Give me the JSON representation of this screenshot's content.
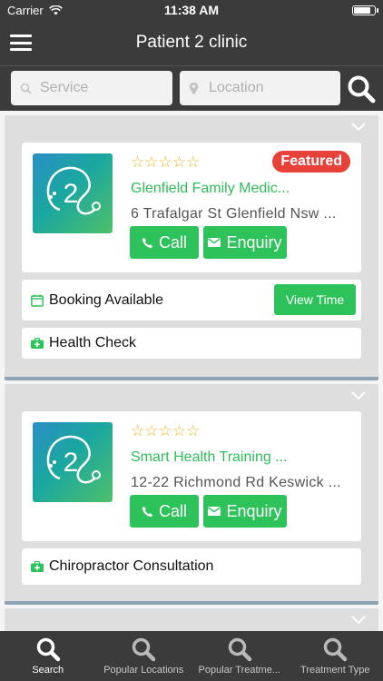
{
  "status_bar": {
    "carrier": "Carrier",
    "time": "11:38 AM"
  },
  "header": {
    "title": "Patient 2 clinic"
  },
  "search": {
    "service_placeholder": "Service",
    "location_placeholder": "Location"
  },
  "colors": {
    "bar": "#3b3b3b",
    "accent_green": "#2dc25a",
    "name_green": "#2fbd5a",
    "featured_red": "#e8413a",
    "star": "#e3b820"
  },
  "listings": [
    {
      "stars": "☆☆☆☆☆",
      "rating": 0,
      "badge": "Featured",
      "name": "Glenfield Family Medic...",
      "address": "6 Trafalgar St Glenfield  Nsw  ...",
      "call_label": "Call",
      "enquiry_label": "Enquiry",
      "booking_label": "Booking Available",
      "view_time_label": "View Time",
      "service": "Health Check"
    },
    {
      "stars": "☆☆☆☆☆",
      "rating": 0,
      "name": "Smart Health Training ...",
      "address": "12-22 Richmond Rd Keswick  ...",
      "call_label": "Call",
      "enquiry_label": "Enquiry",
      "service": "Chiropractor Consultation"
    }
  ],
  "tabs": [
    {
      "label": "Search",
      "icon": "search-icon",
      "active": true
    },
    {
      "label": "Popular Locations",
      "icon": "search-icon"
    },
    {
      "label": "Popular Treatme...",
      "icon": "search-icon"
    },
    {
      "label": "Treatment Type",
      "icon": "search-icon"
    }
  ]
}
